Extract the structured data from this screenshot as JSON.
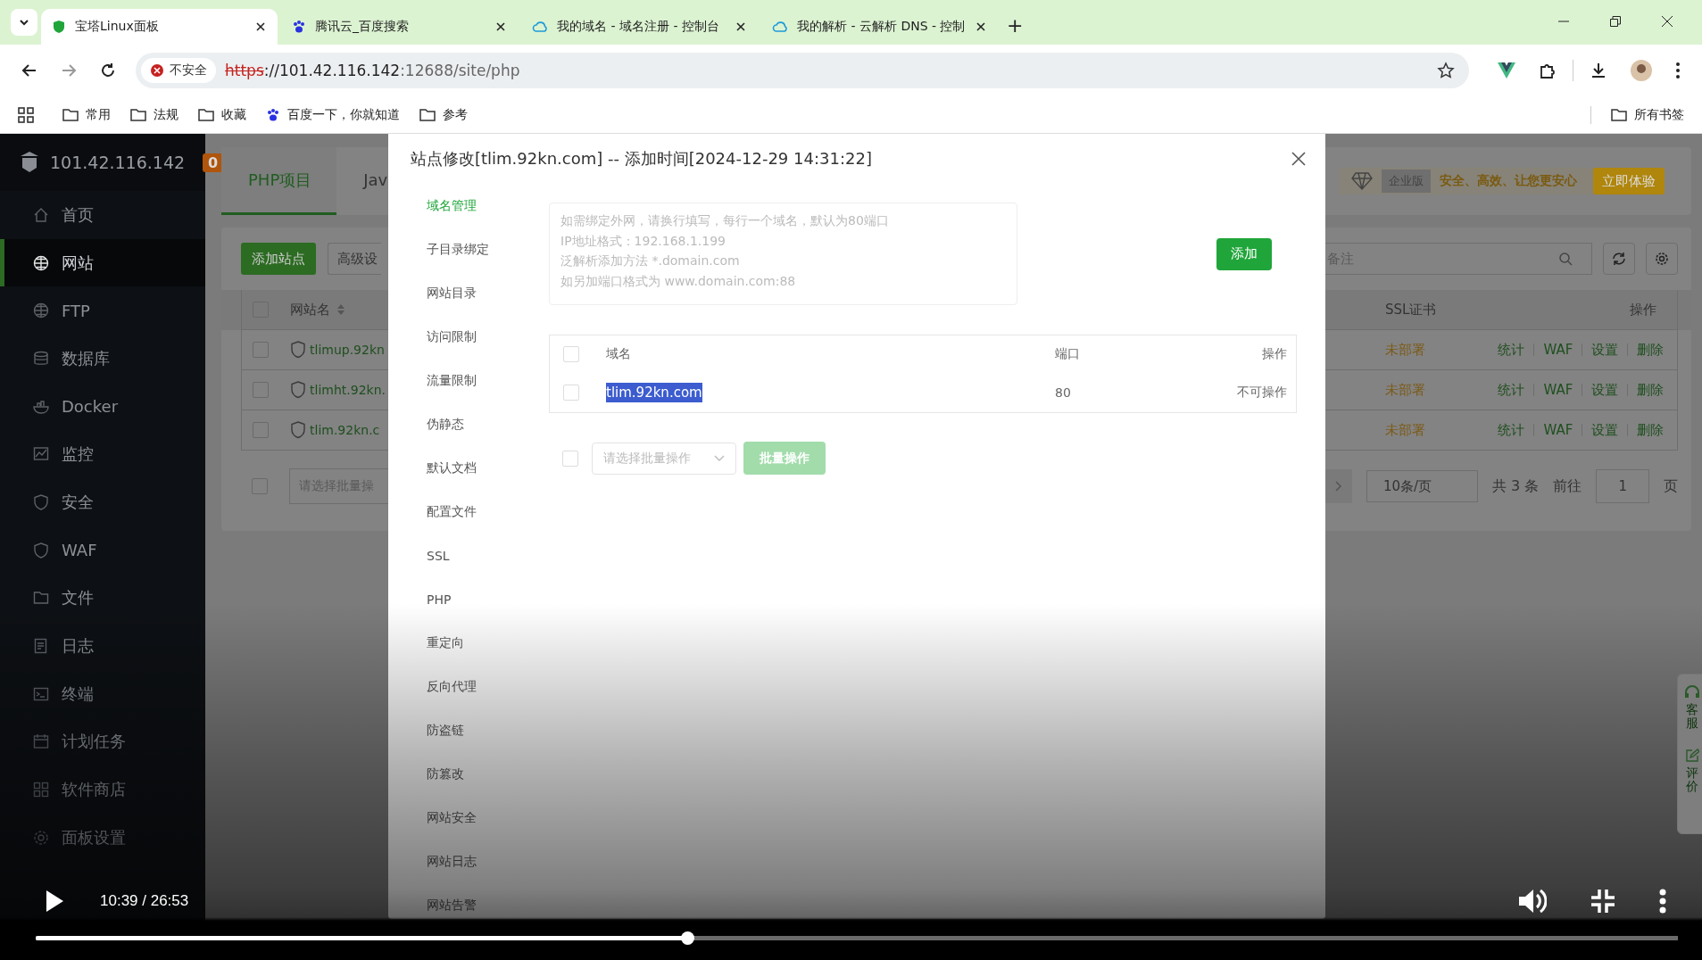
{
  "browser": {
    "tabs": [
      {
        "title": "宝塔Linux面板",
        "selected": true
      },
      {
        "title": "腾讯云_百度搜索",
        "selected": false
      },
      {
        "title": "我的域名 - 域名注册 - 控制台",
        "selected": false
      },
      {
        "title": "我的解析 - 云解析 DNS - 控制",
        "selected": false
      }
    ],
    "new_tab": "+",
    "address": {
      "security": "不安全",
      "scheme": "https",
      "host": "://101.42.116.142",
      "path": ":12688/site/php"
    },
    "bookmarks": [
      {
        "label": "常用",
        "kind": "folder"
      },
      {
        "label": "法规",
        "kind": "folder"
      },
      {
        "label": "收藏",
        "kind": "folder"
      },
      {
        "label": "百度一下，你就知道",
        "kind": "site"
      },
      {
        "label": "参考",
        "kind": "folder"
      }
    ],
    "all_bookmarks": "所有书签"
  },
  "panel": {
    "sidebar": {
      "host": "101.42.116.142",
      "badge": "0",
      "items": [
        {
          "label": "首页",
          "selected": false
        },
        {
          "label": "网站",
          "selected": true
        },
        {
          "label": "FTP",
          "selected": false
        },
        {
          "label": "数据库",
          "selected": false
        },
        {
          "label": "Docker",
          "selected": false
        },
        {
          "label": "监控",
          "selected": false
        },
        {
          "label": "安全",
          "selected": false
        },
        {
          "label": "WAF",
          "selected": false
        },
        {
          "label": "文件",
          "selected": false
        },
        {
          "label": "日志",
          "selected": false
        },
        {
          "label": "终端",
          "selected": false
        },
        {
          "label": "计划任务",
          "selected": false
        },
        {
          "label": "软件商店",
          "selected": false
        },
        {
          "label": "面板设置",
          "selected": false
        }
      ]
    },
    "tabs": [
      {
        "label": "PHP项目",
        "selected": true
      },
      {
        "label": "Jav",
        "selected": false
      }
    ],
    "promo": {
      "tag": "企业版",
      "slogan": "安全、高效、让您更安心",
      "button": "立即体验"
    },
    "toolbar": {
      "add_button": "添加站点",
      "advanced_button": "高级设",
      "search_placeholder": "备注"
    },
    "table": {
      "header_checked": false,
      "columns": [
        "网站名",
        "SSL证书",
        "操作"
      ],
      "rows": [
        {
          "name": "tlimup.92kn",
          "checked": false,
          "ssl": "未部署",
          "actions": [
            "统计",
            "WAF",
            "设置",
            "删除"
          ]
        },
        {
          "name": "tlimht.92kn.",
          "checked": false,
          "ssl": "未部署",
          "actions": [
            "统计",
            "WAF",
            "设置",
            "删除"
          ]
        },
        {
          "name": "tlim.92kn.c",
          "checked": false,
          "ssl": "未部署",
          "actions": [
            "统计",
            "WAF",
            "设置",
            "删除"
          ]
        }
      ]
    },
    "batch_checked": false,
    "batch_select": "请选择批量操",
    "pagination": {
      "page_size": "10条/页",
      "total": "共 3 条",
      "goto": "前往",
      "page": "1",
      "unit": "页"
    },
    "float_panel": [
      {
        "label": "客服"
      },
      {
        "label": "评价"
      }
    ]
  },
  "dialog": {
    "title": "站点修改[tlim.92kn.com] -- 添加时间[2024-12-29 14:31:22]",
    "menu": [
      {
        "label": "域名管理",
        "selected": true
      },
      {
        "label": "子目录绑定",
        "selected": false
      },
      {
        "label": "网站目录",
        "selected": false
      },
      {
        "label": "访问限制",
        "selected": false
      },
      {
        "label": "流量限制",
        "selected": false
      },
      {
        "label": "伪静态",
        "selected": false
      },
      {
        "label": "默认文档",
        "selected": false
      },
      {
        "label": "配置文件",
        "selected": false
      },
      {
        "label": "SSL",
        "selected": false
      },
      {
        "label": "PHP",
        "selected": false
      },
      {
        "label": "重定向",
        "selected": false
      },
      {
        "label": "反向代理",
        "selected": false
      },
      {
        "label": "防盗链",
        "selected": false
      },
      {
        "label": "防篡改",
        "selected": false
      },
      {
        "label": "网站安全",
        "selected": false
      },
      {
        "label": "网站日志",
        "selected": false
      },
      {
        "label": "网站告警",
        "selected": false
      }
    ],
    "domain_input": {
      "placeholder": "如需绑定外网，请换行填写，每行一个域名，默认为80端口\nIP地址格式：192.168.1.199\n泛解析添加方法 *.domain.com\n如另加端口格式为 www.domain.com:88"
    },
    "add_button": "添加",
    "table": {
      "header_checked": false,
      "columns": [
        "域名",
        "端口",
        "操作"
      ],
      "rows": [
        {
          "domain": "tlim.92kn.com",
          "port": "80",
          "action": "不可操作",
          "checked": false,
          "highlighted": true
        }
      ]
    },
    "batch": {
      "checked": false,
      "placeholder": "请选择批量操作",
      "button": "批量操作"
    }
  },
  "video": {
    "time": "10:39 / 26:53",
    "level": 0.397
  }
}
